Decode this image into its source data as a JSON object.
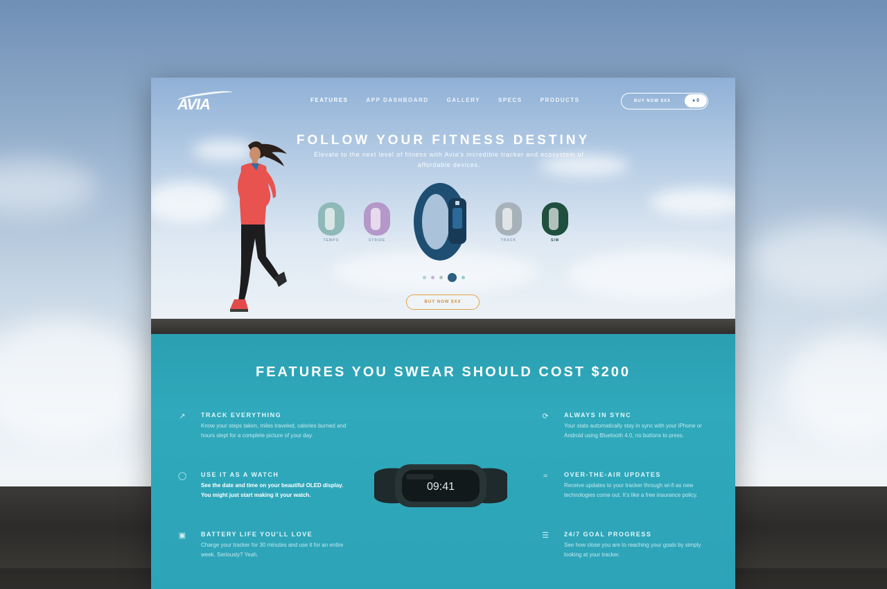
{
  "brand": {
    "logo_text": "AVIA"
  },
  "nav": {
    "items": [
      "FEATURES",
      "APP DASHBOARD",
      "GALLERY",
      "SPECS",
      "PRODUCTS"
    ]
  },
  "header": {
    "buy_button": "BUY NOW $XX",
    "cart_count": "0"
  },
  "hero": {
    "title": "FOLLOW YOUR FITNESS DESTINY",
    "subtitle": "Elevate to the next level of fitness with Avia's incredible tracker and ecosystem of affordable devices.",
    "bands": [
      {
        "name": "TEMPO",
        "color": "#8fb9b8"
      },
      {
        "name": "STRIDE",
        "color": "#b498c9"
      },
      {
        "name": "TRACK",
        "color": "#a7b1b9"
      },
      {
        "name": "SIM",
        "color": "#1f4f3f"
      }
    ],
    "main_band_color": "#1f4e73",
    "carousel_dots": [
      "#a8d5d9",
      "#c5b2d6",
      "#b7bec6",
      "#2d5f82",
      "#8fd0c6"
    ],
    "cta": "BUY NOW $XX"
  },
  "features": {
    "title": "FEATURES YOU SWEAR SHOULD COST $200",
    "tracker_time": "09:41",
    "left": [
      {
        "icon": "chart-arrow-icon",
        "title": "TRACK EVERYTHING",
        "text": "Know your steps taken, miles traveled, calories burned and hours slept for a complete picture of your day.",
        "strong": false
      },
      {
        "icon": "watch-icon",
        "title": "USE IT AS A WATCH",
        "text": "See the date and time on your beautiful OLED display. You might just start making it your watch.",
        "strong": true
      },
      {
        "icon": "battery-icon",
        "title": "BATTERY LIFE YOU'LL LOVE",
        "text": "Charge your tracker for 30 minutes and use it for an entire week. Seriously? Yeah.",
        "strong": false
      }
    ],
    "right": [
      {
        "icon": "sync-icon",
        "title": "ALWAYS IN SYNC",
        "text": "Your stats automatically stay in sync with your iPhone or Android using Bluetooth 4.0, no buttons to press.",
        "strong": false
      },
      {
        "icon": "wifi-icon",
        "title": "OVER-THE-AIR UPDATES",
        "text": "Receive updates to your tracker through wi-fi as new technologies come out. It's like a free insurance policy.",
        "strong": false
      },
      {
        "icon": "goal-icon",
        "title": "24/7 GOAL PROGRESS",
        "text": "See how close you are to reaching your goals by simply looking at your tracker.",
        "strong": false
      }
    ]
  }
}
